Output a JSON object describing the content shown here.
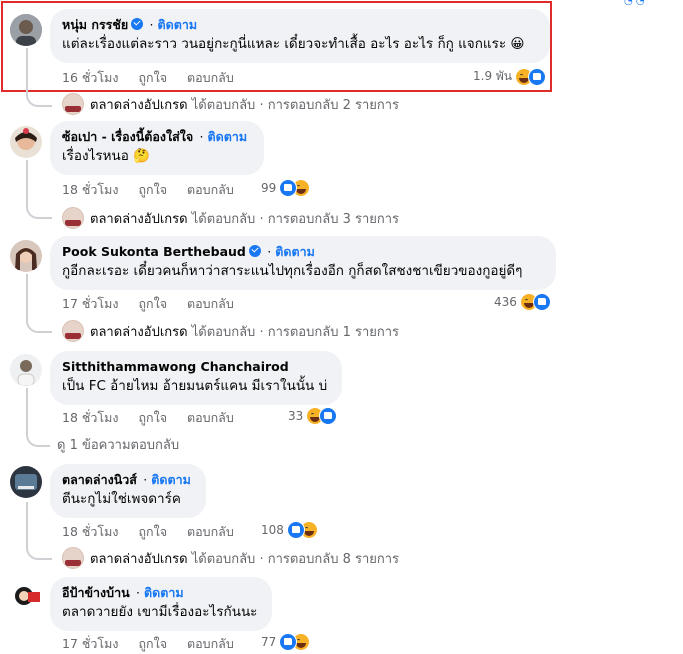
{
  "ui": {
    "follow": "ติดตาม",
    "like": "ถูกใจ",
    "reply": "ตอบกลับ",
    "separator": "·"
  },
  "comments": [
    {
      "name": "หนุ่ม กรรชัย",
      "verified": true,
      "text": "แต่ละเรื่องแต่ละราว วนอยู่กะกูนี่แหละ เดี๋ยวจะทำเสื้อ อะไร อะไร ก็กู แจกแระ 😀",
      "time": "16 ชั่วโมง",
      "reactions": "1.9 พัน",
      "reply_summary": {
        "page": "ตลาดล่างอัปเกรด",
        "action": "ได้ตอบกลับ",
        "count": "· การตอบกลับ 2 รายการ"
      }
    },
    {
      "name": "ซ้อเปา - เรื่องนี้ต้องใส่ใจ",
      "verified": false,
      "text": "เรื่องไรหนอ 🤔",
      "time": "18 ชั่วโมง",
      "reactions": "99",
      "reply_summary": {
        "page": "ตลาดล่างอัปเกรด",
        "action": "ได้ตอบกลับ",
        "count": "· การตอบกลับ 3 รายการ"
      }
    },
    {
      "name": "Pook Sukonta Berthebaud",
      "verified": true,
      "text": "กูอีกละเรอะ เดี๋ยวคนก็หาว่าสาระแนไปทุกเรื่องอีก กูก็สดใสชงชาเขียวของกูอยู่ดีๆ",
      "time": "17 ชั่วโมง",
      "reactions": "436",
      "reply_summary": {
        "page": "ตลาดล่างอัปเกรด",
        "action": "ได้ตอบกลับ",
        "count": "· การตอบกลับ 1 รายการ"
      }
    },
    {
      "name": "Sitthithammawong Chanchairod",
      "verified": false,
      "text": "เป็น FC อ้ายไหม อ้ายมนตร์แคน มีเราในนั้น บ่",
      "time": "18 ชั่วโมง",
      "reactions": "33",
      "more_replies": "ดู 1 ข้อความตอบกลับ"
    },
    {
      "name": "ตลาดล่างนิวส์",
      "verified": false,
      "text": "ตีนะกูไม่ใช่เพจดาร์ค",
      "time": "18 ชั่วโมง",
      "reactions": "108",
      "reply_summary": {
        "page": "ตลาดล่างอัปเกรด",
        "action": "ได้ตอบกลับ",
        "count": "· การตอบกลับ 8 รายการ"
      }
    },
    {
      "name": "อีป้าข้างบ้าน",
      "verified": false,
      "text": "ตลาดวายยัง เขามีเรื่องอะไรกันนะ",
      "time": "17 ชั่วโมง",
      "reactions": "77"
    }
  ],
  "colors": {
    "accent": "#1877f2",
    "bubble": "#f0f2f5",
    "muted": "#65676b",
    "highlight": "#e02b2b"
  }
}
